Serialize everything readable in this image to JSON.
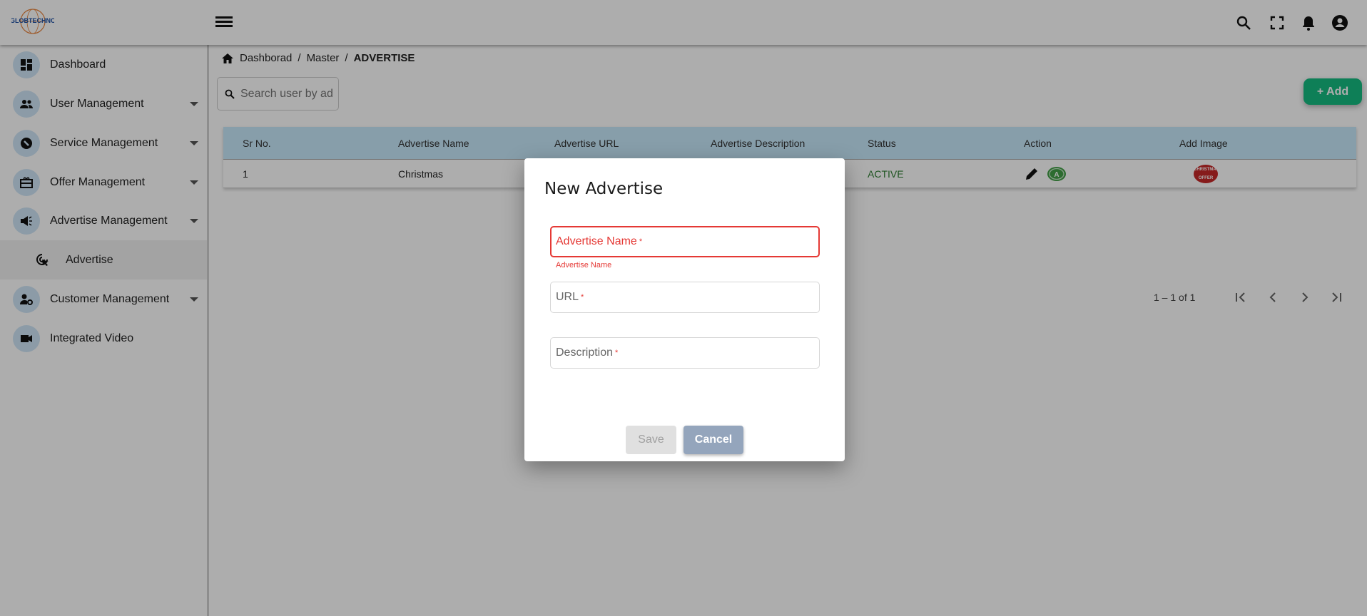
{
  "header": {
    "logo_text": "GLOBTECHNO",
    "icons": [
      "menu-icon",
      "search-icon",
      "fullscreen-icon",
      "bell-icon",
      "account-icon"
    ]
  },
  "sidebar": {
    "items": [
      {
        "label": "Dashboard",
        "icon": "dashboard-icon",
        "expandable": false
      },
      {
        "label": "User Management",
        "icon": "users-icon",
        "expandable": true
      },
      {
        "label": "Service Management",
        "icon": "wrench-icon",
        "expandable": true
      },
      {
        "label": "Offer Management",
        "icon": "gift-card-icon",
        "expandable": true
      },
      {
        "label": "Advertise Management",
        "icon": "campaign-icon",
        "expandable": true
      },
      {
        "label": "Advertise",
        "icon": "ads-click-icon",
        "sub": true,
        "active": true
      },
      {
        "label": "Customer Management",
        "icon": "manage-accounts-icon",
        "expandable": true
      },
      {
        "label": "Integrated Video",
        "icon": "videocam-icon",
        "expandable": false
      }
    ]
  },
  "breadcrumb": [
    "Dashborad",
    "Master",
    "ADVERTISE"
  ],
  "search": {
    "placeholder": "Search user by advertise name"
  },
  "add_button": "+ Add",
  "table": {
    "columns": [
      "Sr No.",
      "Advertise Name",
      "Advertise URL",
      "Advertise Description",
      "Status",
      "Action",
      "Add Image"
    ],
    "rows": [
      {
        "sr": "1",
        "name": "Christmas",
        "url": "",
        "description": "",
        "status": "ACTIVE",
        "image_text": "CHRISTMAS OFFER"
      }
    ],
    "status_color": "#2e7d32"
  },
  "pagination": {
    "range": "1 – 1 of 1"
  },
  "modal": {
    "title": "New Advertise",
    "fields": [
      {
        "label": "Advertise Name",
        "required": "*",
        "error": "Advertise Name"
      },
      {
        "label": "URL",
        "required": "*"
      },
      {
        "label": "Description",
        "required": "*"
      }
    ],
    "save": "Save",
    "cancel": "Cancel"
  },
  "colors": {
    "accent": "#16bb81",
    "error": "#e53935",
    "table_header": "#c7e9fb",
    "cancel": "#94a5bc"
  }
}
